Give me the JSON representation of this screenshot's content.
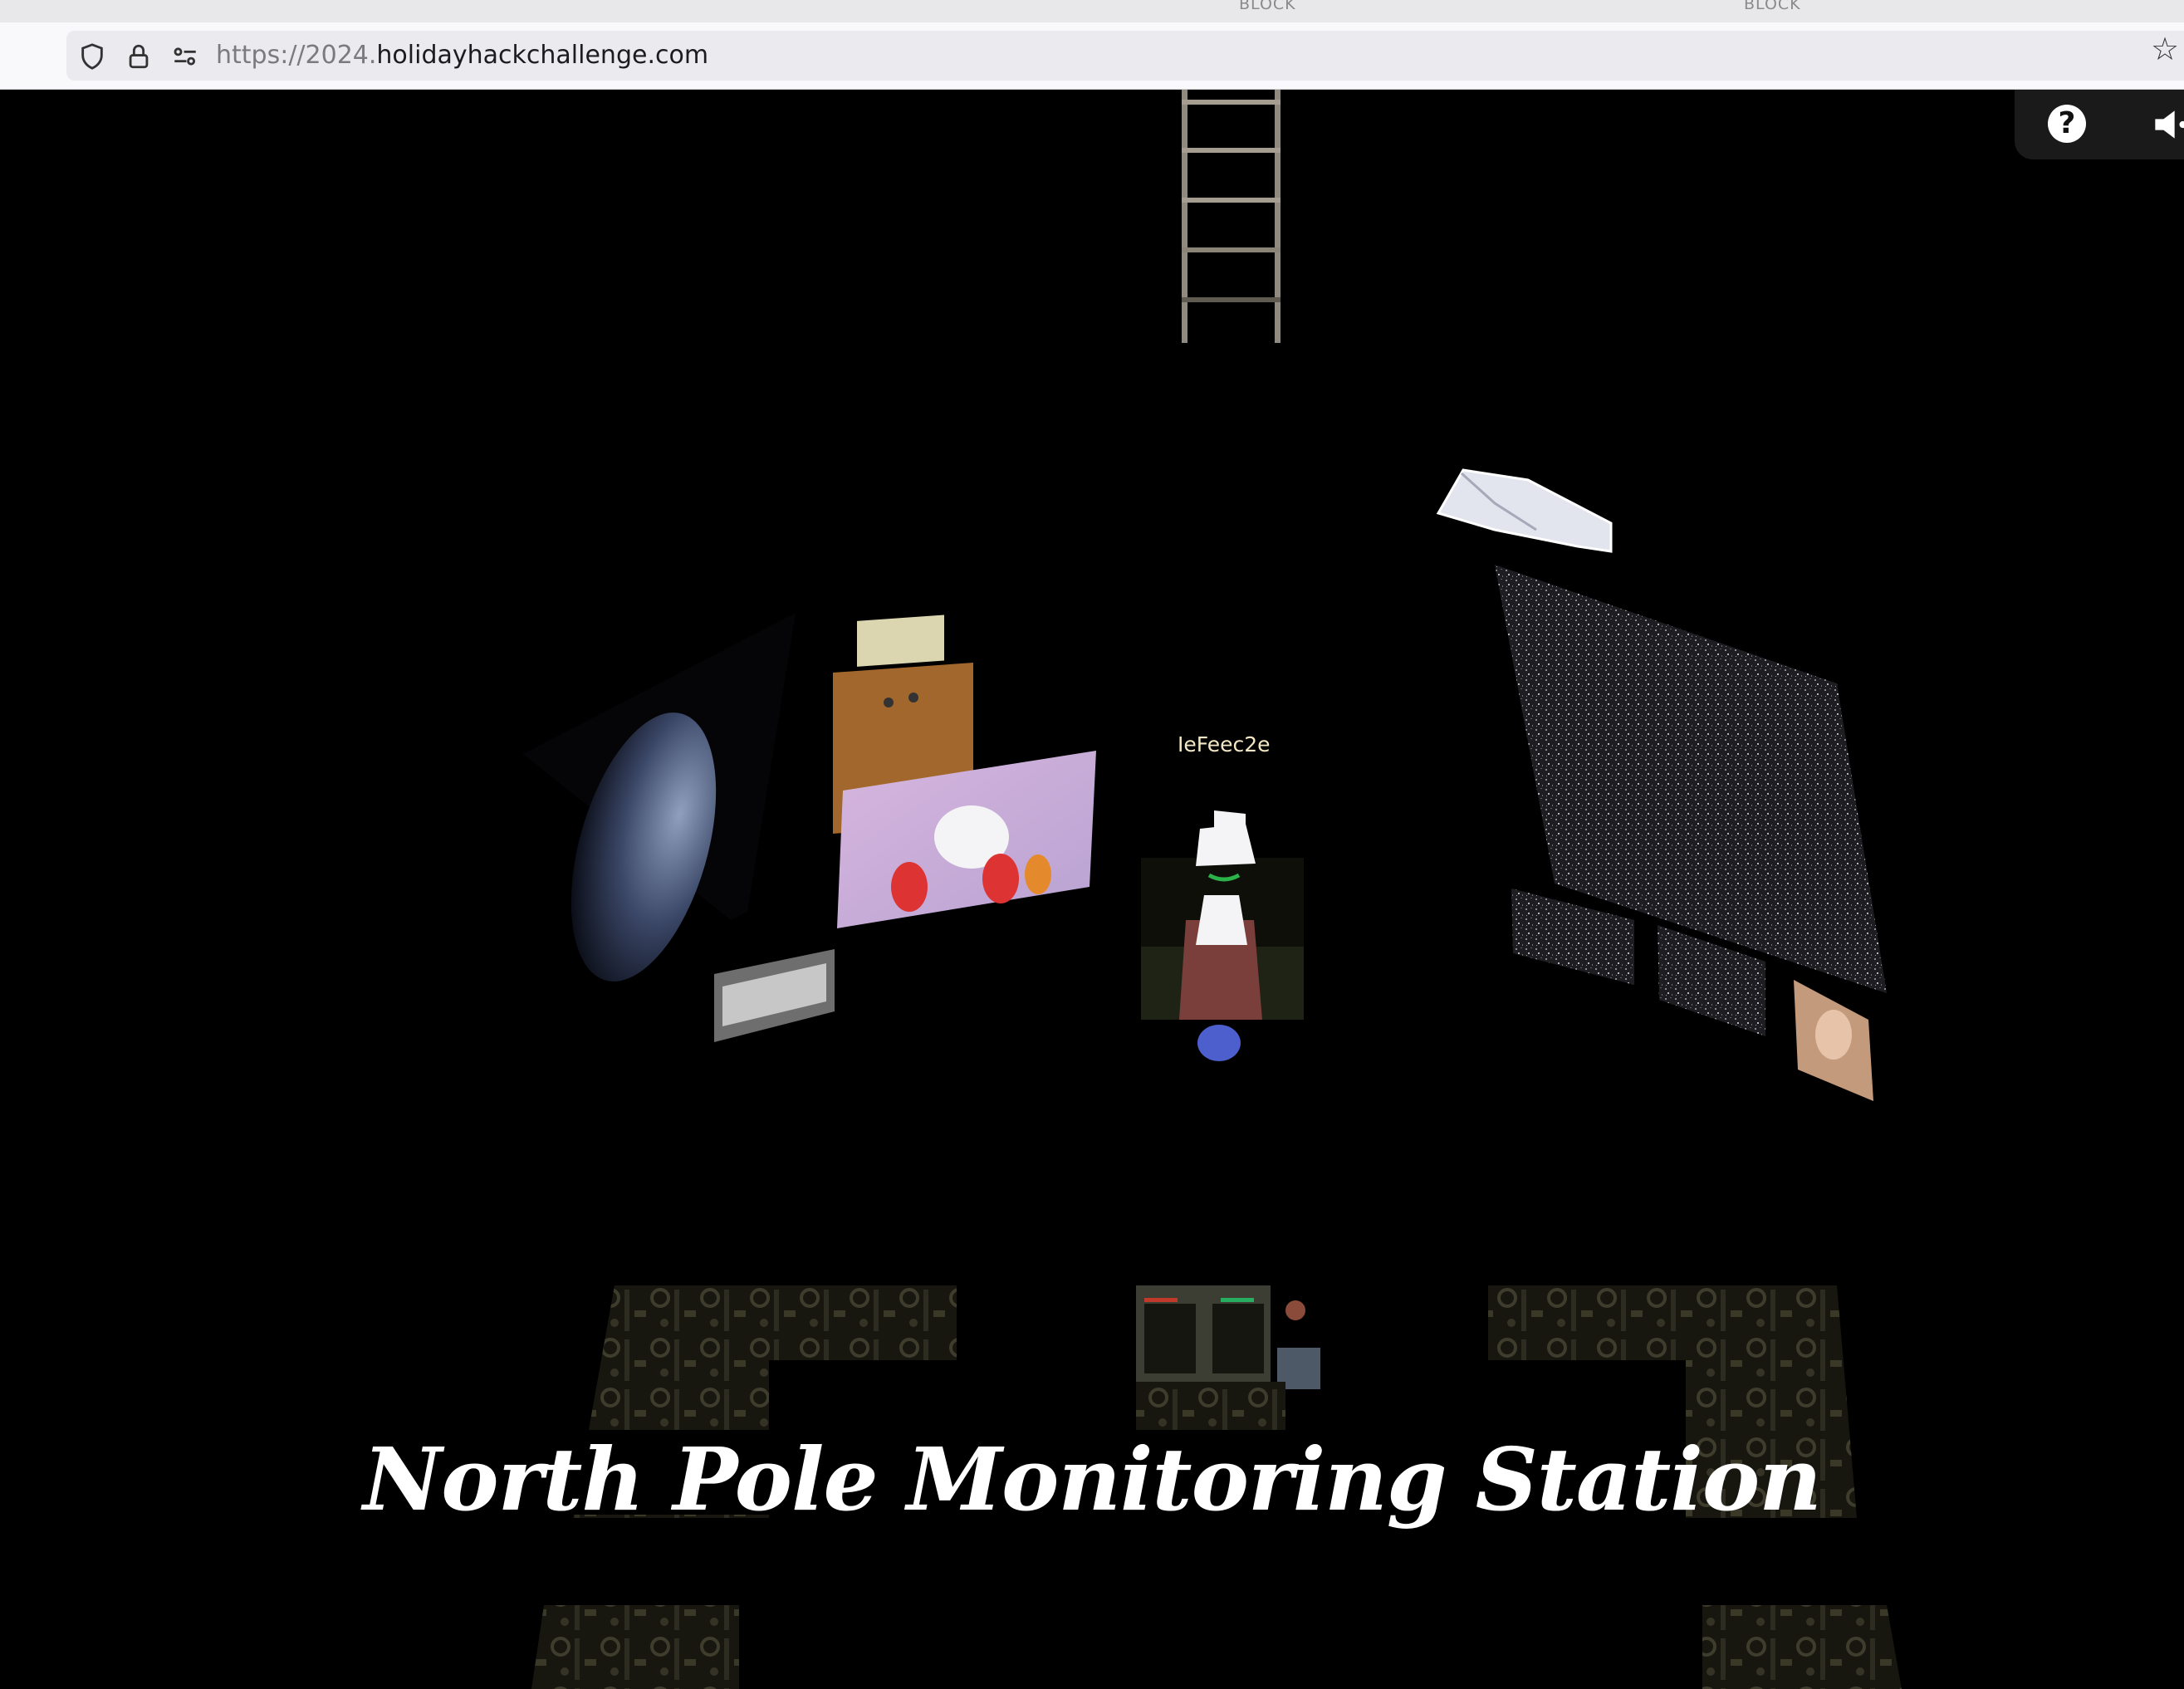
{
  "browser": {
    "tab_hints": [
      "BLOCK",
      "BLOCK"
    ],
    "url_prefix": "https://2024.",
    "url_domain": "holidayhackchallenge.com",
    "icons": [
      "shield-icon",
      "lock-icon",
      "site-settings-icon",
      "bookmark-star-icon"
    ]
  },
  "game": {
    "hud": {
      "help_label": "?",
      "icons": [
        "help-icon",
        "sound-icon"
      ]
    },
    "player": {
      "name": "IeFeec2e"
    },
    "location_title": "North Pole Monitoring Station"
  }
}
